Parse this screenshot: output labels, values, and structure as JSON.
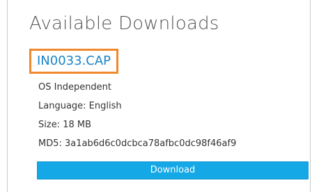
{
  "panel": {
    "title": "Available Downloads",
    "file": {
      "name": "IN0033.CAP"
    },
    "details": {
      "os": "OS Independent",
      "language": "Language: English",
      "size": "Size: 18 MB",
      "md5": "MD5: 3a1ab6d6c0dcbca78afbc0dc98f46af9"
    },
    "download_label": "Download"
  },
  "colors": {
    "link": "#1a84c7",
    "highlight_border": "#f0892b",
    "button_bg": "#14a8e6",
    "heading_text": "#555555",
    "body_text": "#333333"
  }
}
